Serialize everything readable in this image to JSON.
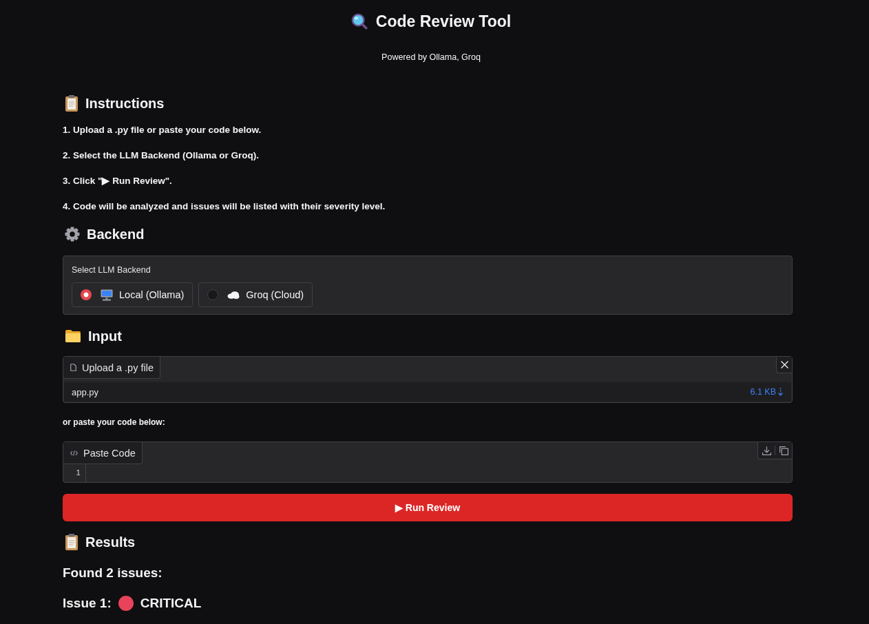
{
  "header": {
    "title": "Code Review Tool",
    "subtitle": "Powered by Ollama, Groq"
  },
  "instructions": {
    "heading": "Instructions",
    "steps": [
      "1. Upload a .py file or paste your code below.",
      "2. Select the LLM Backend (Ollama or Groq).",
      "3. Click \"▶ Run Review\".",
      "4. Code will be analyzed and issues will be listed with their severity level."
    ]
  },
  "backend": {
    "heading": "Backend",
    "label": "Select LLM Backend",
    "options": [
      {
        "label": "Local (Ollama)",
        "kind": "computer",
        "selected": true
      },
      {
        "label": "Groq (Cloud)",
        "kind": "cloud",
        "selected": false
      }
    ]
  },
  "input": {
    "heading": "Input",
    "upload": {
      "label": "Upload a .py file",
      "file_name": "app.py",
      "file_size": "6.1 KB"
    },
    "paste_hint": "or paste your code below:",
    "code": {
      "label": "Paste Code",
      "line_numbers": [
        "1"
      ]
    }
  },
  "run_button": "▶ Run Review",
  "results": {
    "heading": "Results",
    "summary": "Found 2 issues:",
    "issues": [
      {
        "title": "Issue 1:",
        "severity": "CRITICAL",
        "color": "#e8435a"
      }
    ]
  }
}
